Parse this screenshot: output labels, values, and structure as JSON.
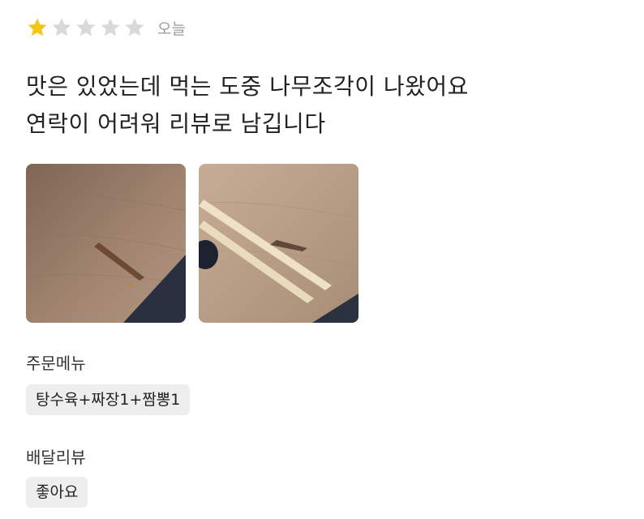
{
  "review": {
    "rating": 1,
    "max_rating": 5,
    "date": "오늘",
    "text_line1": "맛은 있었는데 먹는 도중 나무조각이 나왔어요",
    "text_line2": "연락이 어려워 리뷰로 남깁니다"
  },
  "order": {
    "label": "주문메뉴",
    "menu": "탕수육+짜장1+짬뽕1"
  },
  "delivery": {
    "label": "배달리뷰",
    "value": "좋아요"
  },
  "colors": {
    "star_filled": "#f5c518",
    "star_empty": "#d9d9d9"
  }
}
